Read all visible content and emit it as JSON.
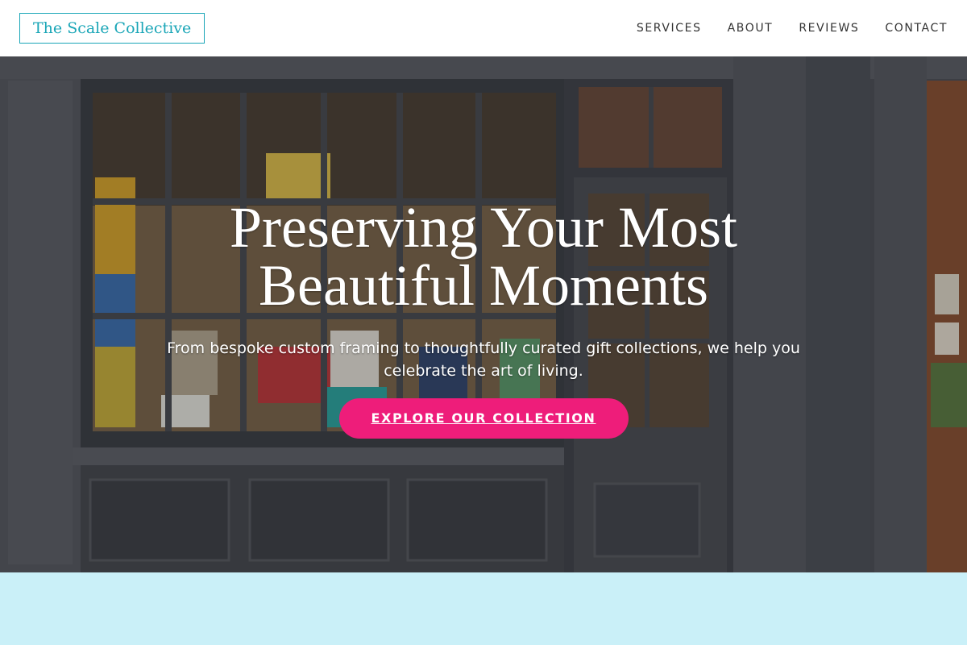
{
  "header": {
    "logo_text": "The Scale Collective",
    "nav": [
      {
        "label": "SERVICES"
      },
      {
        "label": "ABOUT"
      },
      {
        "label": "REVIEWS"
      },
      {
        "label": "CONTACT"
      }
    ]
  },
  "hero": {
    "title": "Preserving Your Most Beautiful Moments",
    "subtitle": "From bespoke custom framing to thoughtfully curated gift collections, we help you celebrate the art of living.",
    "cta_label": "EXPLORE OUR COLLECTION",
    "background_image": "storefront-photo"
  },
  "colors": {
    "brand_teal": "#1aa6b7",
    "accent_pink": "#ee1d7a",
    "lower_section_bg": "#caf0f8",
    "nav_text": "#333333"
  }
}
